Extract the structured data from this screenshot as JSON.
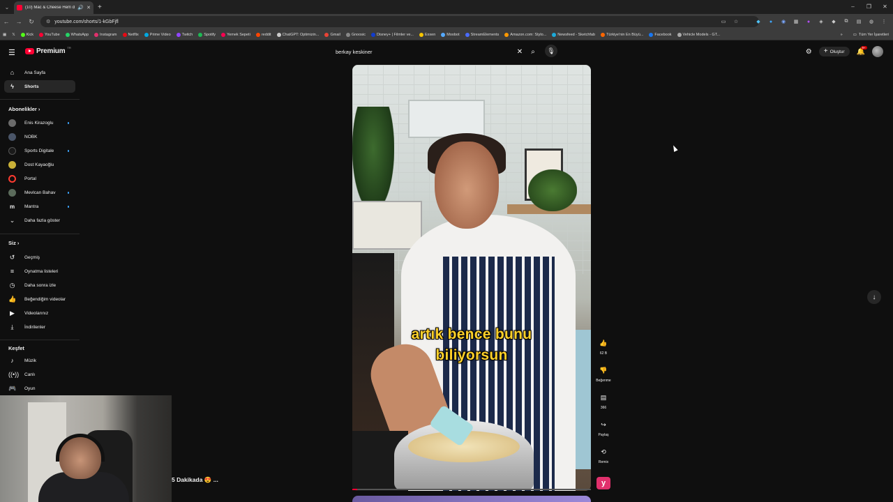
{
  "browser": {
    "tab_title": "(10) Mac & Cheese Hem di",
    "url": "youtube.com/shorts/1-kGbFjfl",
    "bookmarks": [
      {
        "label": "Kick",
        "color": "#53fc18"
      },
      {
        "label": "YouTube",
        "color": "#ff0033"
      },
      {
        "label": "WhatsApp",
        "color": "#25d366"
      },
      {
        "label": "Instagram",
        "color": "#e1306c"
      },
      {
        "label": "Netflix",
        "color": "#e50914"
      },
      {
        "label": "Prime Video",
        "color": "#00a8e1"
      },
      {
        "label": "Twitch",
        "color": "#9146ff"
      },
      {
        "label": "Spotify",
        "color": "#1db954"
      },
      {
        "label": "Yemek Sepeti",
        "color": "#fa0050"
      },
      {
        "label": "reddit",
        "color": "#ff4500"
      },
      {
        "label": "ChatGPT: Optimizin...",
        "color": "#cccccc"
      },
      {
        "label": "Gmail",
        "color": "#ea4335"
      },
      {
        "label": "Gnoosic",
        "color": "#888888"
      },
      {
        "label": "Disney+ | Filmler ve...",
        "color": "#113ccf"
      },
      {
        "label": "Exxen",
        "color": "#f5c400"
      },
      {
        "label": "Moobot",
        "color": "#55aaff"
      },
      {
        "label": "StreamElements",
        "color": "#4a6cff"
      },
      {
        "label": "Amazon.com: Stylo...",
        "color": "#ff9900"
      },
      {
        "label": "Newsfeed - Sketchfab",
        "color": "#1caad9"
      },
      {
        "label": "Türkiye'nin En Büyü...",
        "color": "#ff6600"
      },
      {
        "label": "Facebook",
        "color": "#1877f2"
      },
      {
        "label": "Vehicle Models - GT...",
        "color": "#aaaaaa"
      }
    ],
    "all_bookmarks": "Tüm Yer İşaretleri"
  },
  "header": {
    "logo_text": "Premium",
    "country_code": "TR",
    "search_value": "berkay keskiner",
    "create_label": "Oluştur",
    "notif_badge": "9+"
  },
  "sidebar": {
    "home": "Ana Sayfa",
    "shorts": "Shorts",
    "subscriptions_heading": "Abonelikler",
    "subscriptions": [
      {
        "name": "Enis Kirazoglu",
        "color": "#6b6b6b",
        "dot": true
      },
      {
        "name": "NOBK",
        "color": "#4a5568",
        "dot": false
      },
      {
        "name": "Sports Digitale",
        "color": "#1a1a1a",
        "dot": true
      },
      {
        "name": "Dost Kayaoğlu",
        "color": "#c9b037",
        "dot": false
      },
      {
        "name": "Portal",
        "color": "#ff3b30",
        "dot": false
      },
      {
        "name": "Mevlcan Bahav",
        "color": "#5b6b5b",
        "dot": true
      },
      {
        "name": "Mantra",
        "color": "#222222",
        "dot": true
      }
    ],
    "show_more": "Daha fazla göster",
    "you_heading": "Siz",
    "you_items": [
      "Geçmiş",
      "Oynatma listeleri",
      "Daha sonra izle",
      "Beğendiğim videolar",
      "Videolarınız",
      "İndirilenler"
    ],
    "explore_heading": "Keşfet",
    "explore_items": [
      "Müzik",
      "Canlı",
      "Oyun"
    ]
  },
  "short": {
    "caption_line1": "artık bence bunu",
    "caption_line2": "biliyorsun",
    "progress_fraction": 0.02,
    "like_count": "62 B",
    "dislike_label": "Beğenme",
    "comment_count": "366",
    "share_label": "Paylaş",
    "remix_label": "Remix"
  },
  "overlay": {
    "title": "5 Dakikada 😍 ..."
  },
  "icons": {
    "home": "home-icon",
    "shorts": "shorts-icon",
    "history": "history-icon",
    "like": "thumbs-up-icon",
    "dislike": "thumbs-down-icon",
    "comment": "comment-icon",
    "share": "share-icon",
    "remix": "remix-icon",
    "scroll_down": "arrow-down-icon"
  }
}
